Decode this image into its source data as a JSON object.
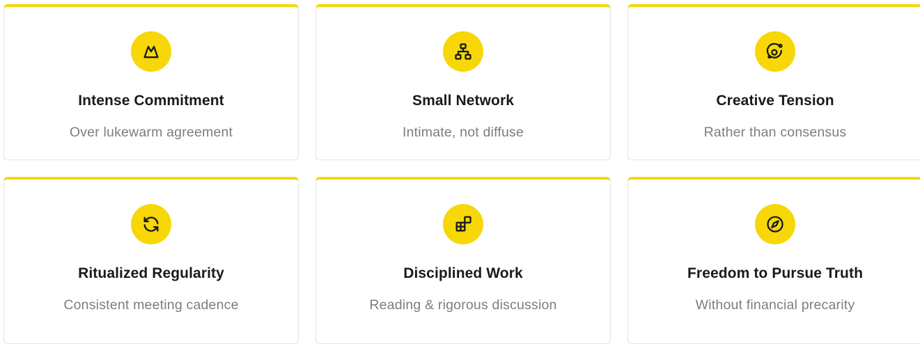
{
  "accent_color": "#f7d708",
  "cards": [
    {
      "icon": "mountain-icon",
      "title": "Intense Commitment",
      "subtitle": "Over lukewarm agreement"
    },
    {
      "icon": "network-icon",
      "title": "Small Network",
      "subtitle": "Intimate, not diffuse"
    },
    {
      "icon": "orbit-icon",
      "title": "Creative Tension",
      "subtitle": "Rather than consensus"
    },
    {
      "icon": "refresh-icon",
      "title": "Ritualized Regularity",
      "subtitle": "Consistent meeting cadence"
    },
    {
      "icon": "blocks-icon",
      "title": "Disciplined Work",
      "subtitle": "Reading & rigorous discussion"
    },
    {
      "icon": "compass-icon",
      "title": "Freedom to Pursue Truth",
      "subtitle": "Without financial precarity"
    }
  ]
}
